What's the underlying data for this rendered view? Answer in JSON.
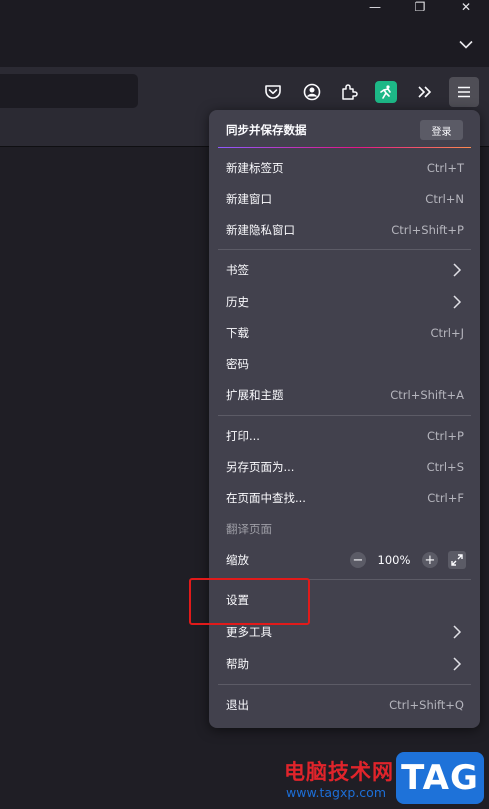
{
  "window": {
    "minimize_glyph": "—",
    "restore_glyph": "❐",
    "close_glyph": "✕"
  },
  "toolbar": {
    "icons": [
      "pocket-icon",
      "account-icon",
      "extensions-icon",
      "extension-green-icon",
      "overflow-chevrons-icon",
      "hamburger-menu-icon"
    ],
    "accent_green": "#1db887"
  },
  "menu": {
    "sync_label": "同步并保存数据",
    "login_label": "登录",
    "items": {
      "new_tab": {
        "label": "新建标签页",
        "shortcut": "Ctrl+T"
      },
      "new_window": {
        "label": "新建窗口",
        "shortcut": "Ctrl+N"
      },
      "new_private": {
        "label": "新建隐私窗口",
        "shortcut": "Ctrl+Shift+P"
      },
      "bookmarks": {
        "label": "书签"
      },
      "history": {
        "label": "历史"
      },
      "downloads": {
        "label": "下载",
        "shortcut": "Ctrl+J"
      },
      "passwords": {
        "label": "密码"
      },
      "addons": {
        "label": "扩展和主题",
        "shortcut": "Ctrl+Shift+A"
      },
      "print": {
        "label": "打印...",
        "shortcut": "Ctrl+P"
      },
      "save_page": {
        "label": "另存页面为...",
        "shortcut": "Ctrl+S"
      },
      "find": {
        "label": "在页面中查找...",
        "shortcut": "Ctrl+F"
      },
      "translate": {
        "label": "翻译页面"
      },
      "zoom": {
        "label": "缩放",
        "minus": "−",
        "value": "100%",
        "plus": "+"
      },
      "settings": {
        "label": "设置"
      },
      "more_tools": {
        "label": "更多工具"
      },
      "help": {
        "label": "帮助"
      },
      "quit": {
        "label": "退出",
        "shortcut": "Ctrl+Shift+Q"
      }
    }
  },
  "annotation": {
    "highlight_color": "#e11a1a"
  },
  "watermark": {
    "site_name": "电脑技术网",
    "url": "www.tagxp.com",
    "logo_text": "TAG"
  }
}
